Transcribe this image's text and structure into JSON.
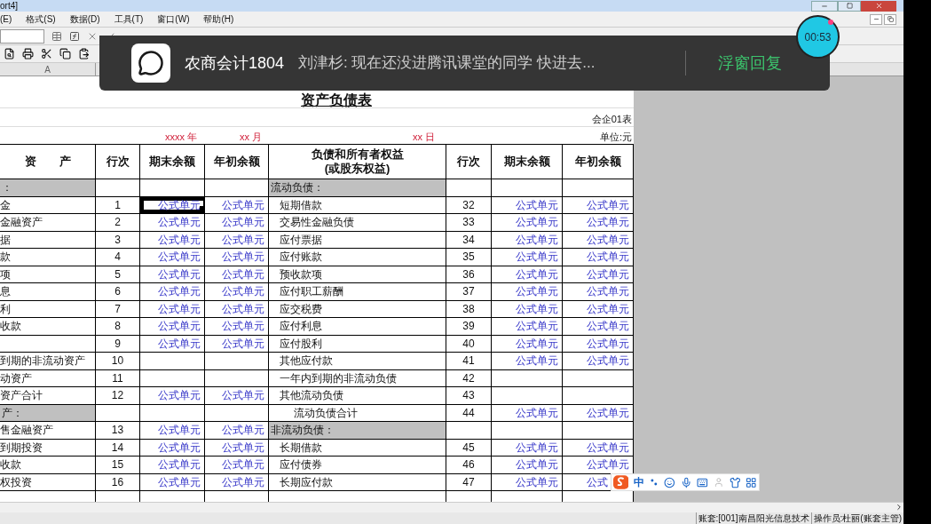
{
  "window": {
    "title": "ort4]"
  },
  "menu": [
    "(E)",
    "格式(S)",
    "数据(D)",
    "工具(T)",
    "窗口(W)",
    "帮助(H)"
  ],
  "column_headers": [
    "A"
  ],
  "sheet": {
    "title": "资产负债表",
    "form_no": "会企01表",
    "year": "xxxx 年",
    "month": "xx 月",
    "day": "xx 日",
    "unit": "单位:元",
    "left_headers": [
      "资　　产",
      "行次",
      "期末余额",
      "年初余额"
    ],
    "right_headers": [
      "负债和所有者权益",
      "(或股东权益)",
      "行次",
      "期末余额",
      "年初余额"
    ],
    "rows": [
      {
        "left": {
          "kind": "section",
          "label": "："
        },
        "right": {
          "kind": "section",
          "label": "流动负债："
        }
      },
      {
        "left": {
          "kind": "item",
          "label": "金",
          "line": "1",
          "end": "公式单元",
          "start": "公式单元",
          "selected": true
        },
        "right": {
          "kind": "item",
          "label": "短期借款",
          "line": "32",
          "end": "公式单元",
          "start": "公式单元"
        }
      },
      {
        "left": {
          "kind": "item",
          "label": "金融资产",
          "line": "2",
          "end": "公式单元",
          "start": "公式单元",
          "selected": false
        },
        "right": {
          "kind": "item",
          "label": "交易性金融负债",
          "line": "33",
          "end": "公式单元",
          "start": "公式单元"
        }
      },
      {
        "left": {
          "kind": "item",
          "label": "据",
          "line": "3",
          "end": "公式单元",
          "start": "公式单元",
          "selected": false
        },
        "right": {
          "kind": "item",
          "label": "应付票据",
          "line": "34",
          "end": "公式单元",
          "start": "公式单元"
        }
      },
      {
        "left": {
          "kind": "item",
          "label": "款",
          "line": "4",
          "end": "公式单元",
          "start": "公式单元",
          "selected": false
        },
        "right": {
          "kind": "item",
          "label": "应付账款",
          "line": "35",
          "end": "公式单元",
          "start": "公式单元"
        }
      },
      {
        "left": {
          "kind": "item",
          "label": "项",
          "line": "5",
          "end": "公式单元",
          "start": "公式单元",
          "selected": false
        },
        "right": {
          "kind": "item",
          "label": "预收款项",
          "line": "36",
          "end": "公式单元",
          "start": "公式单元"
        }
      },
      {
        "left": {
          "kind": "item",
          "label": "息",
          "line": "6",
          "end": "公式单元",
          "start": "公式单元",
          "selected": false
        },
        "right": {
          "kind": "item",
          "label": "应付职工薪酬",
          "line": "37",
          "end": "公式单元",
          "start": "公式单元"
        }
      },
      {
        "left": {
          "kind": "item",
          "label": "利",
          "line": "7",
          "end": "公式单元",
          "start": "公式单元",
          "selected": false
        },
        "right": {
          "kind": "item",
          "label": "应交税费",
          "line": "38",
          "end": "公式单元",
          "start": "公式单元"
        }
      },
      {
        "left": {
          "kind": "item",
          "label": "收款",
          "line": "8",
          "end": "公式单元",
          "start": "公式单元",
          "selected": false
        },
        "right": {
          "kind": "item",
          "label": "应付利息",
          "line": "39",
          "end": "公式单元",
          "start": "公式单元"
        }
      },
      {
        "left": {
          "kind": "item",
          "line": "9",
          "end": "公式单元",
          "start": "公式单元",
          "selected": false
        },
        "right": {
          "kind": "item",
          "label": "应付股利",
          "line": "40",
          "end": "公式单元",
          "start": "公式单元"
        }
      },
      {
        "left": {
          "kind": "item",
          "label": "到期的非流动资产",
          "line": "10",
          "selected": false
        },
        "right": {
          "kind": "item",
          "label": "其他应付款",
          "line": "41",
          "end": "公式单元",
          "start": "公式单元"
        }
      },
      {
        "left": {
          "kind": "item",
          "label": "动资产",
          "line": "11",
          "selected": false
        },
        "right": {
          "kind": "item",
          "label": "一年内到期的非流动负债",
          "line": "42"
        }
      },
      {
        "left": {
          "kind": "item",
          "label": "资产合计",
          "line": "12",
          "end": "公式单元",
          "start": "公式单元",
          "selected": false
        },
        "right": {
          "kind": "item",
          "label": "其他流动负债",
          "line": "43"
        }
      },
      {
        "left": {
          "kind": "section",
          "label": "产："
        },
        "right": {
          "kind": "total",
          "label": "流动负债合计",
          "line": "44",
          "end": "公式单元",
          "start": "公式单元"
        }
      },
      {
        "left": {
          "kind": "item",
          "label": "售金融资产",
          "line": "13",
          "end": "公式单元",
          "start": "公式单元",
          "selected": false
        },
        "right": {
          "kind": "section",
          "label": "非流动负债："
        }
      },
      {
        "left": {
          "kind": "item",
          "label": "到期投资",
          "line": "14",
          "end": "公式单元",
          "start": "公式单元",
          "selected": false
        },
        "right": {
          "kind": "item",
          "label": "长期借款",
          "line": "45",
          "end": "公式单元",
          "start": "公式单元"
        }
      },
      {
        "left": {
          "kind": "item",
          "label": "收款",
          "line": "15",
          "end": "公式单元",
          "start": "公式单元",
          "selected": false
        },
        "right": {
          "kind": "item",
          "label": "应付债券",
          "line": "46",
          "end": "公式单元",
          "start": "公式单元"
        }
      },
      {
        "left": {
          "kind": "item",
          "label": "权投资",
          "line": "16",
          "end": "公式单元",
          "start": "公式单元",
          "selected": false
        },
        "right": {
          "kind": "item",
          "label": "长期应付款",
          "line": "47",
          "end": "公式单元",
          "start": "公式"
        }
      }
    ]
  },
  "notification": {
    "group": "农商会计1804",
    "message": "刘津杉: 现在还没进腾讯课堂的同学 快进去...",
    "action": "浮窗回复"
  },
  "timer": "00:53",
  "ime": {
    "mode": "中"
  },
  "status_bar": [
    "账套:[001]南昌阳光信息技术",
    "操作员:杜丽(账套主管)"
  ]
}
